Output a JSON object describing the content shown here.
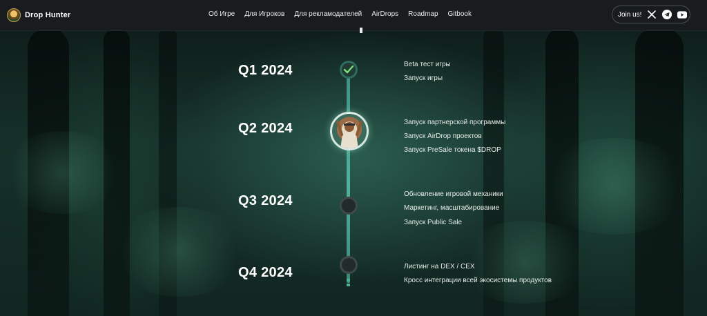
{
  "brand": {
    "name": "Drop Hunter"
  },
  "nav": {
    "links": [
      "Об Игре",
      "Для Игроков",
      "Для рекламодателей",
      "AirDrops",
      "Roadmap",
      "Gitbook"
    ]
  },
  "socials": {
    "join_label": "Join us!",
    "icons": [
      "x-icon",
      "telegram-icon",
      "youtube-icon"
    ]
  },
  "roadmap": [
    {
      "quarter": "Q1 2024",
      "status": "done",
      "items": [
        "Beta тест игры",
        "Запуск игры"
      ]
    },
    {
      "quarter": "Q2 2024",
      "status": "current",
      "items": [
        "Запуск партнерской программы",
        "Запуск AirDrop проектов",
        "Запуск PreSale токена $DROP"
      ]
    },
    {
      "quarter": "Q3 2024",
      "status": "upcoming",
      "items": [
        "Обновление игровой механики",
        "Маркетинг, масштабирование",
        "Запуск Public Sale"
      ]
    },
    {
      "quarter": "Q4 2024",
      "status": "upcoming",
      "items": [
        "Листинг на DEX / CEX",
        "Кросс интеграции всей экосистемы продуктов"
      ]
    }
  ],
  "colors": {
    "background": "#163029",
    "navbar": "#181c1e",
    "timeline_accent": "#52b29c",
    "check": "#7ee07a"
  }
}
